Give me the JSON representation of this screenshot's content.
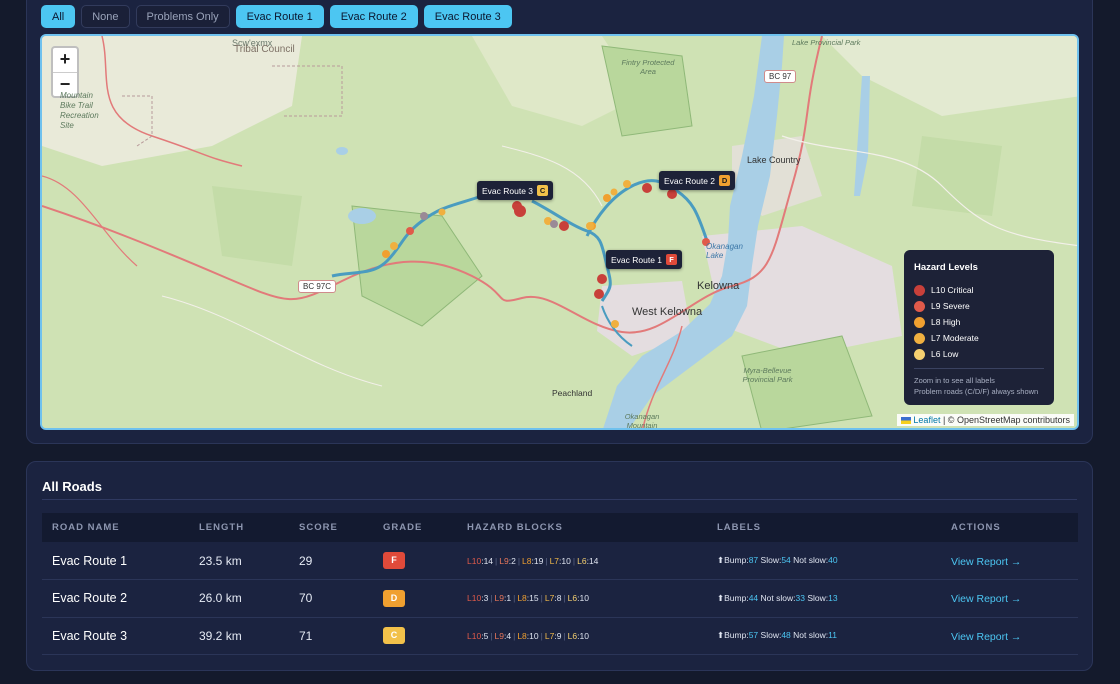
{
  "filters": [
    {
      "label": "All",
      "active": true
    },
    {
      "label": "None",
      "active": false
    },
    {
      "label": "Problems Only",
      "active": false
    },
    {
      "label": "Evac Route 1",
      "active": true
    },
    {
      "label": "Evac Route 2",
      "active": true
    },
    {
      "label": "Evac Route 3",
      "active": true
    }
  ],
  "map": {
    "zoom_in": "+",
    "zoom_out": "−",
    "place_labels": {
      "tribal_council": "Tribal Council",
      "scw": "Scw'exmx",
      "mountain_bike": "Mountain Bike Trail Recreation Site",
      "fintry": "Fintry Protected Area",
      "lake_country": "Lake Country",
      "kelowna": "Kelowna",
      "west_kelowna": "West Kelowna",
      "peachland": "Peachland",
      "okanagan_lake": "Okanagan Lake",
      "okanagan_mountain": "Okanagan Mountain",
      "myra_bellevue": "Myra-Bellevue Provincial Park",
      "kalamalka": "Lake Provincial Park"
    },
    "shields": {
      "bc97c": "BC 97C",
      "bc97": "BC 97"
    },
    "routes": [
      {
        "label": "Evac Route 1",
        "grade": "F",
        "color": "#e04a3a"
      },
      {
        "label": "Evac Route 2",
        "grade": "D",
        "color": "#f0a030"
      },
      {
        "label": "Evac Route 3",
        "grade": "C",
        "color": "#f2c14a"
      }
    ],
    "attribution": {
      "leaflet": "Leaflet",
      "rest": "| © OpenStreetMap contributors"
    }
  },
  "legend": {
    "title": "Hazard Levels",
    "items": [
      {
        "label": "L10 Critical",
        "color": "#c8403a"
      },
      {
        "label": "L9 Severe",
        "color": "#e05a4a"
      },
      {
        "label": "L8 High",
        "color": "#f0a030"
      },
      {
        "label": "L7 Moderate",
        "color": "#f0b040"
      },
      {
        "label": "L6 Low",
        "color": "#f5d070"
      }
    ],
    "note1": "Zoom in to see all labels",
    "note2": "Problem roads (C/D/F) always shown"
  },
  "table": {
    "title": "All Roads",
    "headers": [
      "ROAD NAME",
      "LENGTH",
      "SCORE",
      "GRADE",
      "HAZARD BLOCKS",
      "LABELS",
      "ACTIONS"
    ],
    "rows": [
      {
        "name": "Evac Route 1",
        "length": "23.5 km",
        "score": "29",
        "grade": "F",
        "grade_color": "#e04a3a",
        "hazards": [
          [
            "L10",
            "14"
          ],
          [
            "L9",
            "2"
          ],
          [
            "L8",
            "19"
          ],
          [
            "L7",
            "10"
          ],
          [
            "L6",
            "14"
          ]
        ],
        "labels": [
          [
            "⬆Bump:",
            "87"
          ],
          [
            "Slow:",
            "54"
          ],
          [
            "Not slow:",
            "40"
          ]
        ],
        "action": "View Report →"
      },
      {
        "name": "Evac Route 2",
        "length": "26.0 km",
        "score": "70",
        "grade": "D",
        "grade_color": "#f0a030",
        "hazards": [
          [
            "L10",
            "3"
          ],
          [
            "L9",
            "1"
          ],
          [
            "L8",
            "15"
          ],
          [
            "L7",
            "8"
          ],
          [
            "L6",
            "10"
          ]
        ],
        "labels": [
          [
            "⬆Bump:",
            "44"
          ],
          [
            "Not slow:",
            "33"
          ],
          [
            "Slow:",
            "13"
          ]
        ],
        "action": "View Report →"
      },
      {
        "name": "Evac Route 3",
        "length": "39.2 km",
        "score": "71",
        "grade": "C",
        "grade_color": "#f2c14a",
        "hazards": [
          [
            "L10",
            "5"
          ],
          [
            "L9",
            "4"
          ],
          [
            "L8",
            "10"
          ],
          [
            "L7",
            "9"
          ],
          [
            "L6",
            "10"
          ]
        ],
        "labels": [
          [
            "⬆Bump:",
            "57"
          ],
          [
            "Slow:",
            "48"
          ],
          [
            "Not slow:",
            "11"
          ]
        ],
        "action": "View Report →"
      }
    ],
    "hazard_colors": {
      "L10": "#e05a4a",
      "L9": "#e8765a",
      "L8": "#f0a030",
      "L7": "#f0b84a",
      "L6": "#f5d070"
    }
  }
}
